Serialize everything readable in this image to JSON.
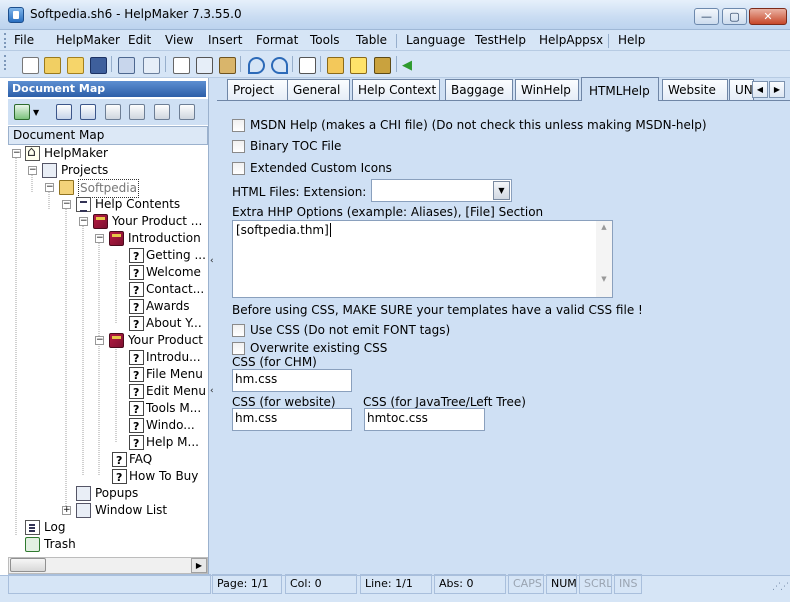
{
  "window": {
    "title": "Softpedia.sh6 - HelpMaker 7.3.55.0",
    "buttons": {
      "minimize": "—",
      "maximize": "▢",
      "close": "✕"
    }
  },
  "menu": {
    "items": [
      "File",
      "HelpMaker",
      "Edit",
      "View",
      "Insert",
      "Format",
      "Tools",
      "Table",
      "Language",
      "TestHelp",
      "HelpAppsx",
      "Help"
    ]
  },
  "toolbar": {
    "icons": [
      "new-icon",
      "open-icon",
      "open-folder-icon",
      "save-icon",
      "properties-icon",
      "spell-check-icon",
      "copy-icon",
      "cut-icon",
      "paste-icon",
      "undo-icon",
      "redo-icon",
      "page-icon",
      "export-icon",
      "help-icon",
      "book-icon",
      "go-icon"
    ]
  },
  "docmap": {
    "header": "Document Map",
    "label": "Document Map",
    "tree": [
      {
        "label": "HelpMaker",
        "icon": "home"
      },
      {
        "label": "Projects",
        "icon": "generic"
      },
      {
        "label": "Softpedia",
        "icon": "folder"
      },
      {
        "label": "Help Contents",
        "icon": "toc"
      },
      {
        "label": "Your Product ...",
        "icon": "book"
      },
      {
        "label": "Introduction",
        "icon": "book"
      },
      {
        "label": "Getting ...",
        "icon": "page"
      },
      {
        "label": "Welcome",
        "icon": "page"
      },
      {
        "label": "Contact...",
        "icon": "page"
      },
      {
        "label": "Awards",
        "icon": "page"
      },
      {
        "label": "About Y...",
        "icon": "page"
      },
      {
        "label": "Your Product",
        "icon": "book"
      },
      {
        "label": "Introdu...",
        "icon": "page"
      },
      {
        "label": "File Menu",
        "icon": "page"
      },
      {
        "label": "Edit Menu",
        "icon": "page"
      },
      {
        "label": "Tools M...",
        "icon": "page"
      },
      {
        "label": "Windo...",
        "icon": "page"
      },
      {
        "label": "Help M...",
        "icon": "page"
      },
      {
        "label": "FAQ",
        "icon": "page"
      },
      {
        "label": "How To Buy",
        "icon": "page"
      },
      {
        "label": "Popups",
        "icon": "generic"
      },
      {
        "label": "Window List",
        "icon": "generic"
      },
      {
        "label": "Log",
        "icon": "log"
      },
      {
        "label": "Trash",
        "icon": "trash"
      }
    ]
  },
  "tabs": {
    "items": [
      "Project",
      "General",
      "Help Context",
      "Baggage",
      "WinHelp",
      "HTMLHelp",
      "Website",
      "UN"
    ],
    "active": "HTMLHelp"
  },
  "htmlhelp": {
    "msdn_help": "MSDN Help (makes a CHI file) (Do not check this unless making MSDN-help)",
    "binary_toc": "Binary TOC File",
    "extended_icons": "Extended Custom Icons",
    "html_ext_label": "HTML Files: Extension:",
    "html_ext_value": "",
    "extra_hhp_label": "Extra HHP Options (example: Aliases), [File] Section",
    "extra_hhp_value": "[softpedia.thm]",
    "css_note": "Before using CSS, MAKE SURE your templates have a valid CSS file !",
    "use_css": "Use CSS (Do not emit FONT tags)",
    "overwrite_css": "Overwrite existing CSS",
    "css_chm_label": "CSS (for CHM)",
    "css_chm_value": "hm.css",
    "css_web_label": "CSS (for website)",
    "css_web_value": "hm.css",
    "css_tree_label": "CSS (for JavaTree/Left Tree)",
    "css_tree_value": "hmtoc.css"
  },
  "status": {
    "page": "Page: 1/1",
    "col": "Col: 0",
    "line": "Line: 1/1",
    "abs": "Abs: 0",
    "caps": "CAPS",
    "num": "NUM",
    "scrl": "SCRL",
    "ins": "INS"
  }
}
